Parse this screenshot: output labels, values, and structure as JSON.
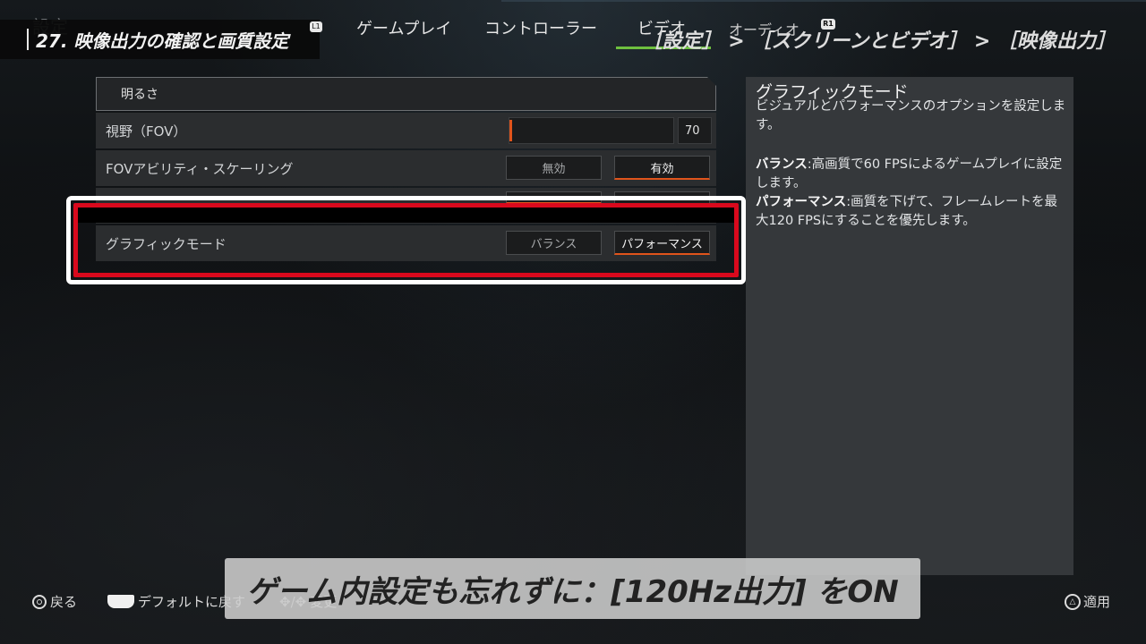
{
  "ghost_title": "設定",
  "title_banner": "27. 映像出力の確認と画質設定",
  "bumper_left": "L1",
  "bumper_right": "R1",
  "tabs": [
    {
      "label": "ゲームプレイ"
    },
    {
      "label": "コントローラー"
    },
    {
      "label": "ビデオ"
    },
    {
      "label": "オーディオ"
    }
  ],
  "active_tab": "ビデオ",
  "breadcrumb": "［設定］ > ［スクリーンとビデオ］ > ［映像出力］",
  "settings": {
    "brightness": {
      "label": "明るさ"
    },
    "fov": {
      "label": "視野（FOV）",
      "value": "70"
    },
    "fov_scaling": {
      "label": "FOVアビリティ・スケーリング",
      "options": [
        "無効",
        "有効"
      ],
      "selected": "有効"
    },
    "graphics_mode": {
      "label": "グラフィックモード",
      "options": [
        "バランス",
        "パフォーマンス"
      ],
      "selected": "パフォーマンス"
    }
  },
  "description": {
    "title": "グラフィックモード",
    "intro": "ビジュアルとパフォーマンスのオプションを設定します。",
    "balance_term": "バランス",
    "balance_text": ":高画質で60 FPSによるゲームプレイに設定します。",
    "performance_term": "パフォーマンス",
    "performance_text": ":画質を下げて、フレームレートを最大120 FPSにすることを優先します。"
  },
  "footer": {
    "back": "戻る",
    "default": "デフォルトに戻す",
    "change": "変更",
    "apply": "適用"
  },
  "caption": "ゲーム内設定も忘れずに：[120Hz出力] をON",
  "colors": {
    "accent_orange": "#e0541b",
    "tab_green": "#6ec03f",
    "highlight_red": "#d9091d"
  }
}
